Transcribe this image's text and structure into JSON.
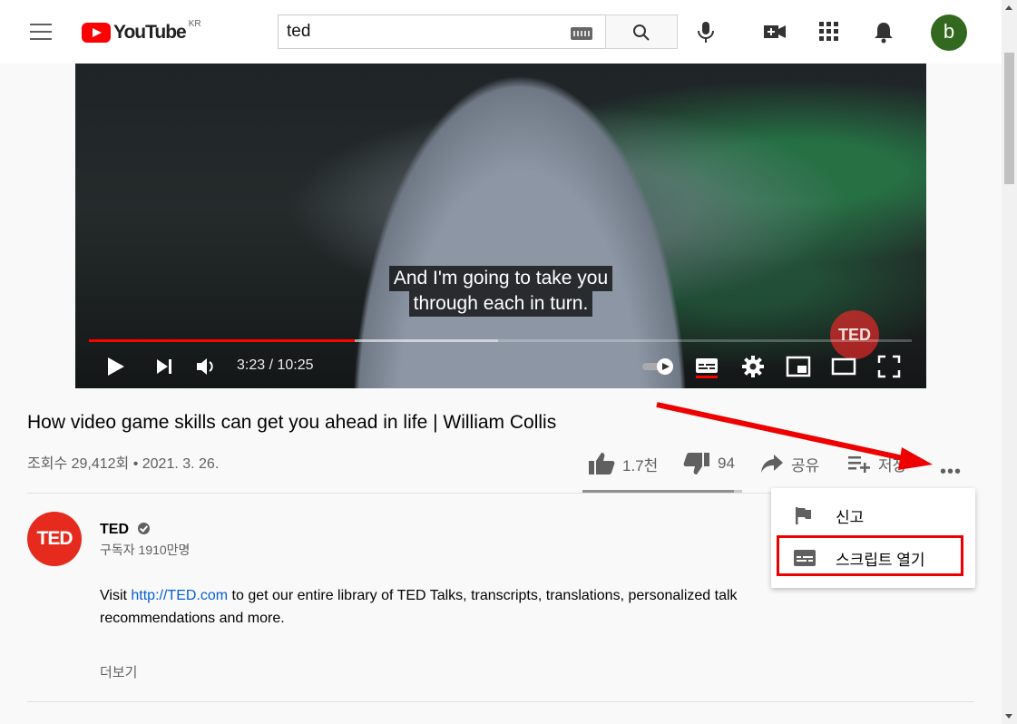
{
  "masthead": {
    "logo_text": "YouTube",
    "region": "KR",
    "search_value": "ted",
    "avatar_letter": "b"
  },
  "player": {
    "caption_line1": "And I'm going to take you",
    "caption_line2": "through each in turn.",
    "time": "3:23 / 10:25",
    "progress_fraction": 0.323,
    "buffered_fraction": 0.497,
    "watermark": "TED"
  },
  "video": {
    "title": "How video game skills can get you ahead in life | William Collis",
    "meta": "조회수 29,412회 • 2021. 3. 26.",
    "likes": "1.7천",
    "dislikes": "94",
    "share_label": "공유",
    "save_label": "저장",
    "like_ratio": 0.95
  },
  "channel": {
    "avatar_text": "TED",
    "name": "TED",
    "subscribers": "구독자 1910만명",
    "description_prefix": "Visit ",
    "description_link": "http://TED.com",
    "description_suffix": " to get our entire library of TED Talks, transcripts, translations, personalized talk recommendations and more.",
    "more_label": "더보기"
  },
  "menu": {
    "items": [
      {
        "label": "신고",
        "icon": "flag-icon"
      },
      {
        "label": "스크립트 열기",
        "icon": "transcript-icon"
      }
    ]
  },
  "colors": {
    "brand_red": "#ff0000",
    "annotation_red": "#e00000",
    "link_blue": "#065fd4",
    "avatar_green": "#33691e"
  }
}
